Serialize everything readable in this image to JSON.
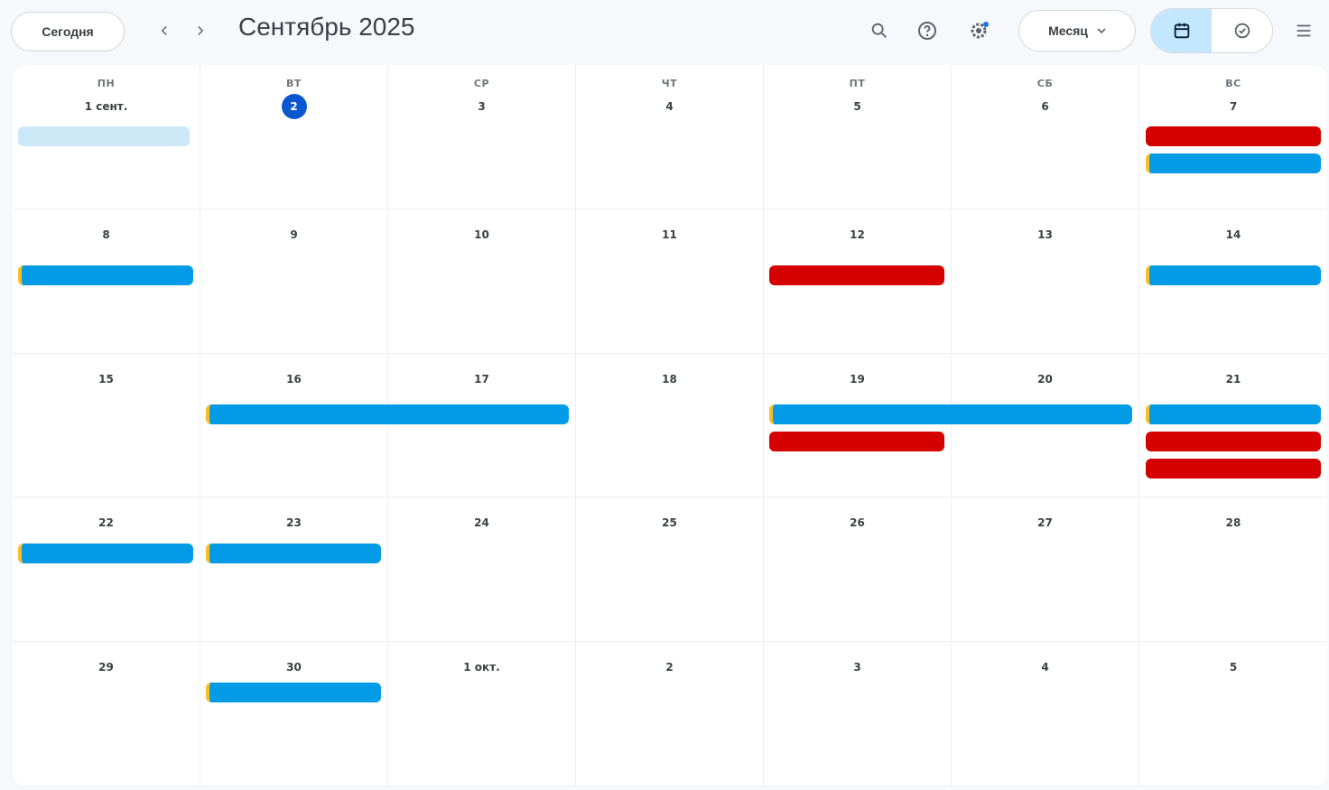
{
  "toolbar": {
    "today_label": "Сегодня",
    "title": "Сентябрь 2025",
    "view_label": "Месяц",
    "prev_icon": "chevron-left-icon",
    "next_icon": "chevron-right-icon",
    "search_icon": "search-icon",
    "help_icon": "help-icon",
    "settings_icon": "settings-icon",
    "calendar_view_icon": "calendar-view-icon",
    "tasks_view_icon": "tasks-view-icon",
    "apps_icon": "apps-grid-icon"
  },
  "weekdays": [
    "ПН",
    "ВТ",
    "СР",
    "ЧТ",
    "ПТ",
    "СБ",
    "ВС"
  ],
  "cells": [
    {
      "date": "1 сент."
    },
    {
      "date": "2",
      "today": true
    },
    {
      "date": "3"
    },
    {
      "date": "4"
    },
    {
      "date": "5"
    },
    {
      "date": "6"
    },
    {
      "date": "7"
    },
    {
      "date": "8"
    },
    {
      "date": "9"
    },
    {
      "date": "10"
    },
    {
      "date": "11"
    },
    {
      "date": "12"
    },
    {
      "date": "13"
    },
    {
      "date": "14"
    },
    {
      "date": "15"
    },
    {
      "date": "16"
    },
    {
      "date": "17"
    },
    {
      "date": "18"
    },
    {
      "date": "19"
    },
    {
      "date": "20"
    },
    {
      "date": "21"
    },
    {
      "date": "22"
    },
    {
      "date": "23"
    },
    {
      "date": "24"
    },
    {
      "date": "25"
    },
    {
      "date": "26"
    },
    {
      "date": "27"
    },
    {
      "date": "28"
    },
    {
      "date": "29"
    },
    {
      "date": "30"
    },
    {
      "date": "1 окт."
    },
    {
      "date": "2"
    },
    {
      "date": "3"
    },
    {
      "date": "4"
    },
    {
      "date": "5"
    }
  ],
  "events": [
    {
      "title": "",
      "color": "#cde9f7"
    },
    {
      "title": "",
      "color": "#d50000"
    },
    {
      "title": "",
      "color": "#039be5"
    },
    {
      "title": "",
      "color": "#039be5"
    },
    {
      "title": "",
      "color": "#d50000"
    },
    {
      "title": "",
      "color": "#039be5"
    },
    {
      "title": "",
      "color": "#039be5"
    },
    {
      "title": "",
      "color": "#039be5"
    },
    {
      "title": "",
      "color": "#d50000"
    },
    {
      "title": "",
      "color": "#039be5"
    },
    {
      "title": "",
      "color": "#d50000"
    },
    {
      "title": "",
      "color": "#d50000"
    },
    {
      "title": "",
      "color": "#039be5"
    },
    {
      "title": "",
      "color": "#039be5"
    },
    {
      "title": "",
      "color": "#039be5"
    }
  ],
  "colors": {
    "accent": "#0b57d0",
    "event_blue": "#039be5",
    "event_red": "#d50000",
    "active_toggle": "#c2e7ff"
  }
}
